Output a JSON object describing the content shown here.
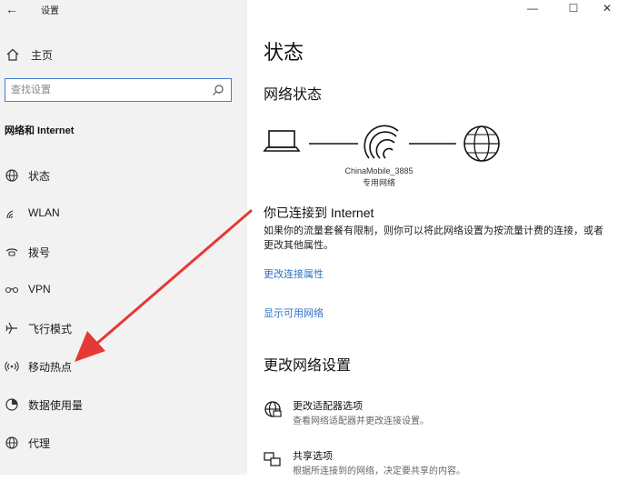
{
  "window": {
    "title": "设置",
    "back_glyph": "←",
    "controls": {
      "minimize": "—",
      "maximize": "☐",
      "close": "✕"
    }
  },
  "sidebar": {
    "home_label": "主页",
    "search_placeholder": "查找设置",
    "section_title": "网络和 Internet",
    "items": [
      {
        "label": "状态",
        "icon": "globe-status-icon"
      },
      {
        "label": "WLAN",
        "icon": "wifi-icon"
      },
      {
        "label": "拨号",
        "icon": "dialup-icon"
      },
      {
        "label": "VPN",
        "icon": "vpn-icon"
      },
      {
        "label": "飞行模式",
        "icon": "airplane-icon"
      },
      {
        "label": "移动热点",
        "icon": "hotspot-icon"
      },
      {
        "label": "数据使用量",
        "icon": "data-usage-icon"
      },
      {
        "label": "代理",
        "icon": "proxy-globe-icon"
      }
    ]
  },
  "main": {
    "title": "状态",
    "network_status_heading": "网络状态",
    "network_name": "ChinaMobile_3885",
    "network_type": "专用网络",
    "connected_title": "你已连接到 Internet",
    "connected_desc": "如果你的流量套餐有限制，则你可以将此网络设置为按流量计费的连接，或者更改其他属性。",
    "link_change_props": "更改连接属性",
    "link_show_networks": "显示可用网络",
    "change_settings_heading": "更改网络设置",
    "options": [
      {
        "title": "更改适配器选项",
        "desc": "查看网络适配器并更改连接设置。",
        "icon": "adapter-icon"
      },
      {
        "title": "共享选项",
        "desc": "根据所连接到的网络，决定要共享的内容。",
        "icon": "sharing-icon"
      }
    ]
  },
  "colors": {
    "sidebar_bg": "#f2f2f2",
    "link": "#2e73c8",
    "search_border": "#3f7fd1",
    "annotation_arrow": "#e53935"
  }
}
